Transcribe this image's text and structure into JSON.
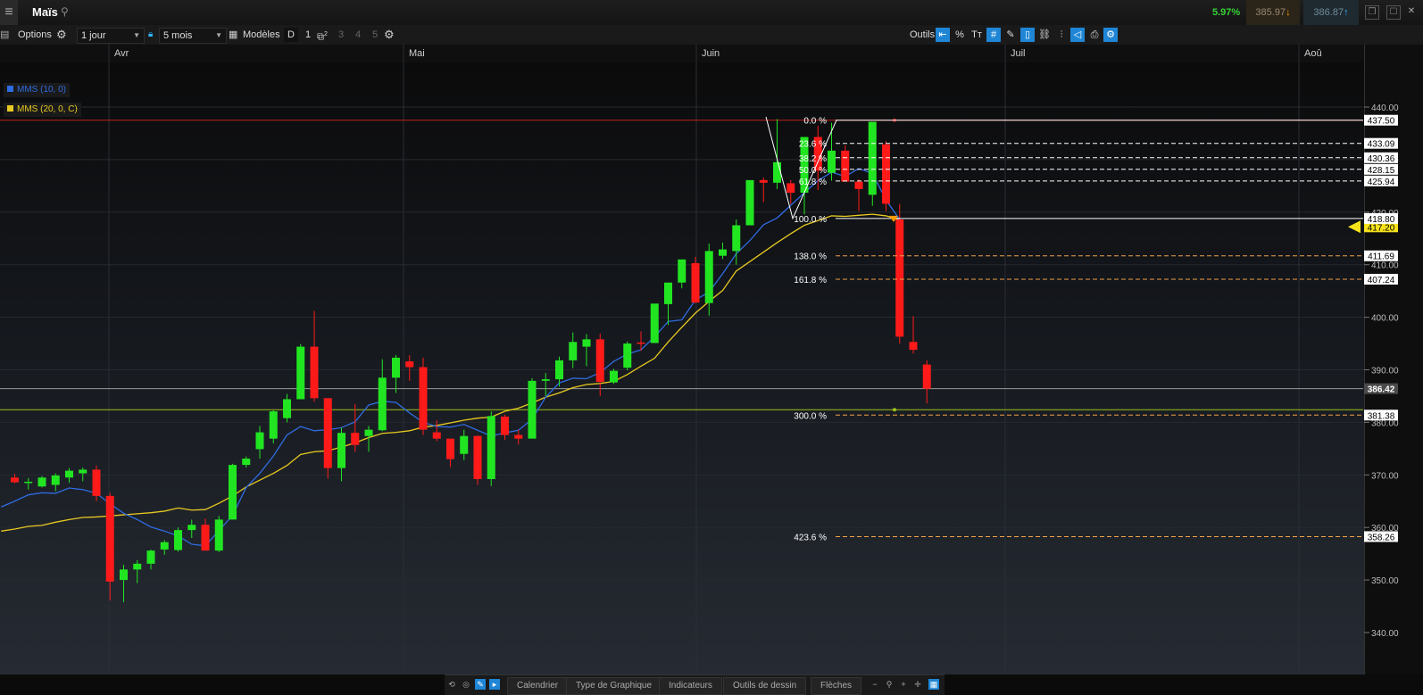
{
  "header": {
    "title": "Maïs",
    "change_pct": "5.97%",
    "bid": "385.97",
    "ask": "386.87"
  },
  "toolbar": {
    "options_label": "Options",
    "interval_value": "1 jour",
    "period_value": "5 mois",
    "models_label": "Modèles",
    "mode_d": "D",
    "mode_1": "1",
    "mode_2": "2",
    "mode_3": "3",
    "mode_4": "4",
    "mode_5": "5",
    "tools_label": "Outils"
  },
  "icons": {
    "menu": "menu-icon",
    "search": "search-icon",
    "gear": "gear-icon",
    "lock": "lock-icon",
    "calendar": "calendar-icon"
  },
  "legend": {
    "ma10": "MMS (10, 0)",
    "ma20": "MMS (20, 0, C)"
  },
  "bottom_tabs": [
    "Calendrier",
    "Type de Graphique",
    "Indicateurs",
    "Outils de dessin",
    "Flèches"
  ],
  "colors": {
    "up": "#22e522",
    "down": "#ff1a1a",
    "ma10": "#2f6be0",
    "ma20": "#e7c921",
    "fib_main": "#ffffff",
    "fib_ext": "#f0a04a",
    "resistance": "#c0201f",
    "support": "#9fc21c"
  },
  "chart_data": {
    "type": "candlestick",
    "x_labels": [
      "Avr",
      "Mai",
      "Juin",
      "Juil",
      "Aoû"
    ],
    "y_ticks": [
      "440.00",
      "430.00",
      "420.00",
      "410.00",
      "400.00",
      "390.00",
      "380.00",
      "370.00",
      "360.00",
      "350.00",
      "340.00"
    ],
    "ylim": [
      336,
      442
    ],
    "price_tags": [
      "437.50",
      "433.09",
      "430.36",
      "428.15",
      "425.94",
      "418.80",
      "417.20",
      "411.69",
      "407.24",
      "386.42",
      "381.38",
      "358.26"
    ],
    "current_price": "386.42",
    "fibonacci": [
      {
        "level": "0.0 %",
        "price": 437.5
      },
      {
        "level": "23.6 %",
        "price": 433.09
      },
      {
        "level": "38.2 %",
        "price": 430.36
      },
      {
        "level": "50.0 %",
        "price": 428.15
      },
      {
        "level": "61.8 %",
        "price": 425.94
      },
      {
        "level": "100.0 %",
        "price": 418.8
      },
      {
        "level": "138.0 %",
        "price": 411.69
      },
      {
        "level": "161.8 %",
        "price": 407.24
      },
      {
        "level": "300.0 %",
        "price": 381.38
      },
      {
        "level": "423.6 %",
        "price": 358.26
      }
    ],
    "candles": [
      [
        369.5,
        370.2,
        368.4,
        368.6
      ],
      [
        368.6,
        369.4,
        367.2,
        368.7
      ],
      [
        367.8,
        369.8,
        367.6,
        369.5
      ],
      [
        368.1,
        370.3,
        366.9,
        369.9
      ],
      [
        369.5,
        371.3,
        368.5,
        370.8
      ],
      [
        370.3,
        371.4,
        368.8,
        371.0
      ],
      [
        371.0,
        371.8,
        365.0,
        366.0
      ],
      [
        366.0,
        366.6,
        346.1,
        349.7
      ],
      [
        350.0,
        352.9,
        345.8,
        352.0
      ],
      [
        352.0,
        353.8,
        349.4,
        353.1
      ],
      [
        353.1,
        355.8,
        352.0,
        355.6
      ],
      [
        355.8,
        357.6,
        354.8,
        357.2
      ],
      [
        355.7,
        360.0,
        355.4,
        359.5
      ],
      [
        359.5,
        361.5,
        358.0,
        360.5
      ],
      [
        360.5,
        361.7,
        355.6,
        355.6
      ],
      [
        355.6,
        362.2,
        355.3,
        361.5
      ],
      [
        361.5,
        372.1,
        361.7,
        371.9
      ],
      [
        371.9,
        373.5,
        371.4,
        373.1
      ],
      [
        374.9,
        379.3,
        373.1,
        378.1
      ],
      [
        376.9,
        382.3,
        376.0,
        382.1
      ],
      [
        380.8,
        385.4,
        380.0,
        384.4
      ],
      [
        384.4,
        394.9,
        385.9,
        394.4
      ],
      [
        394.4,
        401.2,
        383.9,
        384.6
      ],
      [
        384.6,
        383.7,
        369.3,
        371.3
      ],
      [
        371.3,
        379.0,
        368.8,
        378.0
      ],
      [
        378.0,
        383.5,
        374.4,
        375.7
      ],
      [
        377.4,
        379.3,
        374.4,
        378.6
      ],
      [
        378.5,
        392.0,
        378.3,
        388.5
      ],
      [
        388.5,
        392.8,
        385.6,
        392.3
      ],
      [
        391.6,
        392.8,
        387.9,
        390.5
      ],
      [
        390.5,
        392.3,
        377.6,
        378.6
      ],
      [
        378.1,
        380.4,
        376.4,
        376.9
      ],
      [
        376.9,
        376.1,
        371.5,
        373.0
      ],
      [
        374.0,
        378.6,
        372.8,
        377.4
      ],
      [
        377.4,
        377.5,
        368.1,
        369.2
      ],
      [
        369.2,
        382.1,
        367.9,
        381.2
      ],
      [
        381.1,
        381.5,
        376.7,
        377.6
      ],
      [
        377.6,
        378.6,
        375.8,
        376.9
      ],
      [
        376.9,
        388.4,
        377.8,
        387.9
      ],
      [
        387.9,
        389.4,
        385.0,
        388.2
      ],
      [
        388.2,
        392.5,
        386.8,
        391.8
      ],
      [
        391.8,
        397.1,
        390.3,
        395.3
      ],
      [
        394.4,
        396.8,
        390.7,
        395.8
      ],
      [
        395.8,
        396.9,
        385.0,
        387.7
      ],
      [
        387.6,
        390.2,
        387.3,
        389.8
      ],
      [
        390.4,
        395.4,
        389.9,
        395.0
      ],
      [
        395.2,
        397.3,
        393.6,
        395.1
      ],
      [
        395.1,
        399.4,
        395.1,
        402.6
      ],
      [
        402.5,
        405.1,
        398.5,
        406.6
      ],
      [
        406.6,
        411.0,
        405.5,
        411.0
      ],
      [
        410.3,
        411.5,
        402.7,
        402.8
      ],
      [
        402.7,
        414.0,
        400.3,
        412.6
      ],
      [
        411.7,
        414.2,
        411.1,
        412.9
      ],
      [
        412.6,
        418.6,
        410.0,
        417.5
      ],
      [
        417.5,
        426.0,
        417.5,
        426.1
      ],
      [
        426.1,
        426.6,
        421.9,
        425.6
      ],
      [
        425.6,
        437.7,
        424.4,
        429.5
      ],
      [
        425.5,
        426.1,
        421.6,
        423.7
      ],
      [
        423.7,
        430.3,
        419.6,
        434.3
      ],
      [
        434.3,
        436.4,
        424.2,
        427.9
      ],
      [
        427.5,
        437.0,
        426.0,
        431.7
      ],
      [
        431.7,
        432.7,
        426.5,
        425.8
      ],
      [
        425.8,
        426.3,
        420.2,
        424.4
      ],
      [
        423.3,
        437.2,
        421.2,
        437.2
      ],
      [
        432.9,
        433.5,
        420.2,
        421.6
      ],
      [
        418.6,
        421.6,
        395.0,
        396.3
      ],
      [
        395.3,
        400.2,
        393.1,
        393.8
      ],
      [
        391.0,
        391.8,
        383.6,
        386.4
      ]
    ],
    "ma10": [
      363.9,
      365.0,
      366.2,
      366.6,
      366.5,
      367.5,
      367.2,
      366.5,
      364.5,
      362.7,
      361.5,
      360.1,
      359.3,
      358.4,
      356.8,
      356.5,
      359.4,
      362.3,
      367.6,
      370.3,
      373.6,
      377.6,
      379.2,
      378.4,
      378.6,
      379.0,
      380.1,
      383.3,
      384.0,
      383.8,
      381.8,
      380.0,
      379.2,
      379.1,
      379.6,
      378.5,
      377.4,
      378.0,
      378.5,
      380.6,
      384.8,
      387.5,
      388.4,
      388.3,
      389.5,
      391.6,
      393.0,
      393.8,
      396.3,
      399.2,
      399.5,
      403.3,
      404.8,
      408.3,
      412.1,
      414.6,
      417.6,
      418.9,
      421.3,
      423.7,
      426.0,
      427.6,
      426.8,
      428.3,
      427.4,
      422.3,
      418.6
    ],
    "ma20": [
      359.3,
      359.7,
      360.2,
      360.4,
      361.0,
      361.5,
      361.9,
      362.0,
      362.2,
      362.4,
      362.6,
      362.8,
      363.1,
      363.7,
      363.3,
      363.4,
      364.6,
      366.0,
      367.7,
      369.0,
      370.3,
      371.8,
      373.9,
      374.4,
      374.6,
      375.3,
      376.1,
      377.1,
      377.9,
      378.1,
      378.4,
      379.1,
      379.4,
      379.9,
      380.4,
      380.8,
      381.0,
      382.1,
      382.7,
      383.7,
      384.8,
      385.6,
      386.6,
      387.2,
      387.4,
      387.8,
      389.1,
      390.7,
      392.2,
      395.3,
      398.1,
      400.8,
      403.0,
      405.1,
      408.8,
      410.6,
      412.4,
      414.2,
      415.9,
      417.5,
      418.4,
      419.3,
      419.2,
      419.4,
      419.6,
      419.3,
      418.5
    ]
  }
}
